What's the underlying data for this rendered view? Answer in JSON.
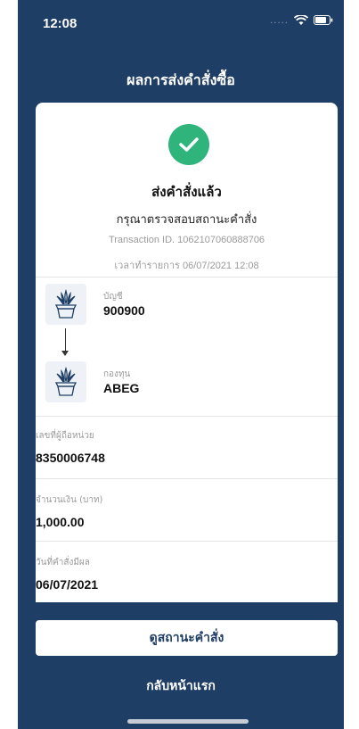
{
  "status_bar": {
    "time": "12:08",
    "dots": "....."
  },
  "header": {
    "title": "ผลการส่งคำสั่งซื้อ"
  },
  "result": {
    "heading": "ส่งคำสั่งแล้ว",
    "message": "กรุณาตรวจสอบสถานะคำสั่ง",
    "transaction": "Transaction ID. 1062107060888706",
    "transaction_time": "เวลาทำรายการ 06/07/2021 12:08"
  },
  "from": {
    "label": "บัญชี",
    "value": "900900"
  },
  "to": {
    "label": "กองทุน",
    "value": "ABEG"
  },
  "details": [
    {
      "label": "เลขที่ผู้ถือหน่วย",
      "value": "8350006748"
    },
    {
      "label": "จำนวนเงิน (บาท)",
      "value": "1,000.00"
    },
    {
      "label": "วันที่คำสั่งมีผล",
      "value": "06/07/2021"
    }
  ],
  "buttons": {
    "view_status": "ดูสถานะคำสั่ง",
    "back_home": "กลับหน้าแรก"
  },
  "colors": {
    "primary": "#1f3e66",
    "success": "#2fb47c"
  }
}
